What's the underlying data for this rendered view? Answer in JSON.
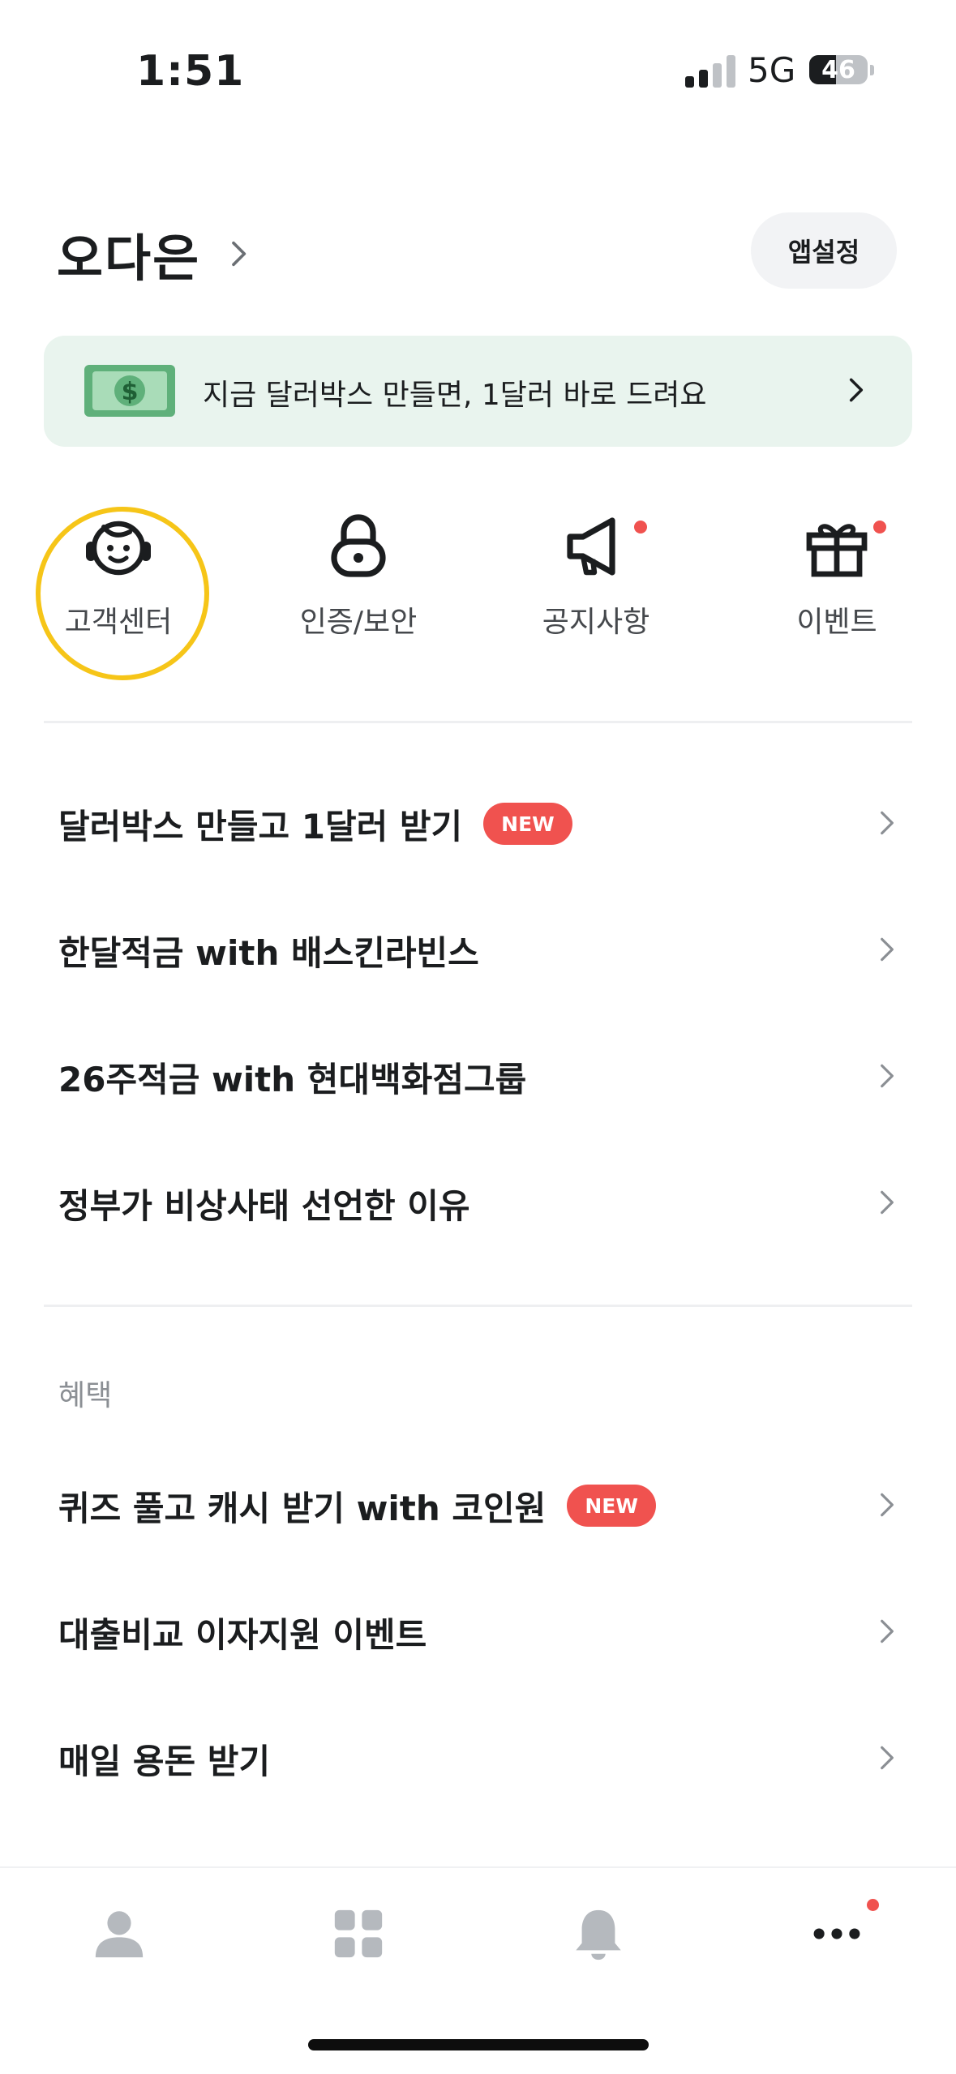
{
  "status_bar": {
    "time": "1:51",
    "network": "5G",
    "battery": "46",
    "battery_level": 0.46
  },
  "header": {
    "profile_name": "오다은",
    "settings_label": "앱설정"
  },
  "banner": {
    "text": "지금 달러박스 만들면, 1달러 바로 드려요",
    "icon": "dollar-bill-icon"
  },
  "quick_menu": [
    {
      "label": "고객센터",
      "icon": "headset-icon",
      "has_dot": false,
      "highlighted": true
    },
    {
      "label": "인증/보안",
      "icon": "lock-icon",
      "has_dot": false
    },
    {
      "label": "공지사항",
      "icon": "megaphone-icon",
      "has_dot": true
    },
    {
      "label": "이벤트",
      "icon": "gift-icon",
      "has_dot": true
    }
  ],
  "list": [
    {
      "label": "달러박스 만들고 1달러 받기",
      "badge": "NEW"
    },
    {
      "label": "한달적금 with 배스킨라빈스"
    },
    {
      "label": "26주적금 with 현대백화점그룹"
    },
    {
      "label": "정부가 비상사태 선언한 이유"
    }
  ],
  "benefits": {
    "title": "혜택",
    "items": [
      {
        "label": "퀴즈 풀고 캐시 받기 with 코인원",
        "badge": "NEW"
      },
      {
        "label": "대출비교 이자지원 이벤트"
      },
      {
        "label": "매일 용돈 받기"
      }
    ]
  },
  "bottom_nav": [
    {
      "icon": "person-icon"
    },
    {
      "icon": "grid-icon"
    },
    {
      "icon": "bell-icon"
    },
    {
      "icon": "more-icon",
      "has_dot": true
    }
  ],
  "colors": {
    "accent_red": "#f0524f",
    "highlight": "#f6c518",
    "banner_bg": "#e9f4ee",
    "bill_green": "#5fb07a"
  }
}
